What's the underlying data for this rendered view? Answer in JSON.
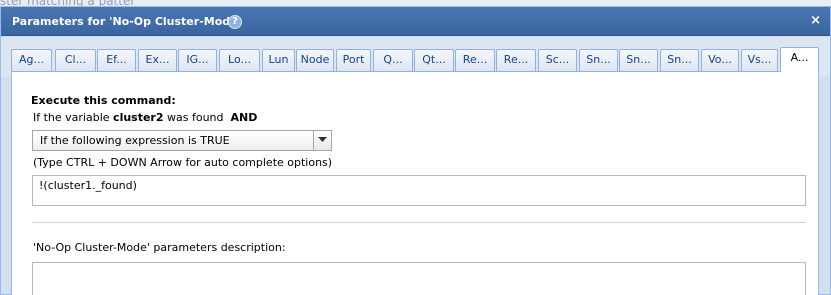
{
  "background": {
    "text": "ster matching a patter"
  },
  "window": {
    "title": "Parameters for 'No-Op Cluster-Mode'",
    "help_glyph": "?",
    "close_glyph": "×"
  },
  "tabs": [
    {
      "label": "Ag..."
    },
    {
      "label": "Cl..."
    },
    {
      "label": "Ef..."
    },
    {
      "label": "Ex..."
    },
    {
      "label": "IG..."
    },
    {
      "label": "Lo..."
    },
    {
      "label": "Lun"
    },
    {
      "label": "Node"
    },
    {
      "label": "Port"
    },
    {
      "label": "Q..."
    },
    {
      "label": "Qt..."
    },
    {
      "label": "Re..."
    },
    {
      "label": "Re..."
    },
    {
      "label": "Sc..."
    },
    {
      "label": "Sn..."
    },
    {
      "label": "Sn..."
    },
    {
      "label": "Sn..."
    },
    {
      "label": "Vo..."
    },
    {
      "label": "Vs..."
    },
    {
      "label": "A...",
      "active": true
    }
  ],
  "form": {
    "section_title": "Execute this command:",
    "condition_prefix": "If the variable",
    "condition_variable": "cluster2",
    "condition_suffix": "was found",
    "condition_operator": "AND",
    "select_value": "If the following expression is TRUE",
    "hint": "(Type CTRL + DOWN Arrow for auto complete options)",
    "expression": "!(cluster1._found)",
    "description_label": "'No-Op Cluster-Mode' parameters description:",
    "description_value": ""
  },
  "colors": {
    "titlebar": "#4a76b3",
    "tab_border": "#8db2e3",
    "tab_text": "#15428b",
    "window_bg": "#d3dfee"
  }
}
